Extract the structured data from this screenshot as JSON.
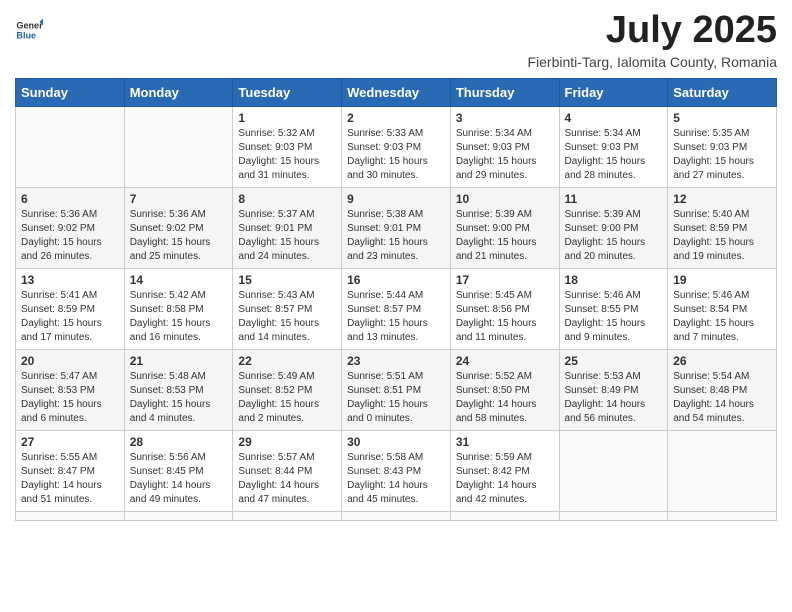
{
  "logo": {
    "text_general": "General",
    "text_blue": "Blue"
  },
  "title": {
    "month": "July 2025",
    "location": "Fierbinti-Targ, Ialomita County, Romania"
  },
  "weekdays": [
    "Sunday",
    "Monday",
    "Tuesday",
    "Wednesday",
    "Thursday",
    "Friday",
    "Saturday"
  ],
  "days": [
    null,
    null,
    {
      "num": "1",
      "sunrise": "5:32 AM",
      "sunset": "9:03 PM",
      "daylight": "15 hours and 31 minutes."
    },
    {
      "num": "2",
      "sunrise": "5:33 AM",
      "sunset": "9:03 PM",
      "daylight": "15 hours and 30 minutes."
    },
    {
      "num": "3",
      "sunrise": "5:34 AM",
      "sunset": "9:03 PM",
      "daylight": "15 hours and 29 minutes."
    },
    {
      "num": "4",
      "sunrise": "5:34 AM",
      "sunset": "9:03 PM",
      "daylight": "15 hours and 28 minutes."
    },
    {
      "num": "5",
      "sunrise": "5:35 AM",
      "sunset": "9:03 PM",
      "daylight": "15 hours and 27 minutes."
    },
    {
      "num": "6",
      "sunrise": "5:36 AM",
      "sunset": "9:02 PM",
      "daylight": "15 hours and 26 minutes."
    },
    {
      "num": "7",
      "sunrise": "5:36 AM",
      "sunset": "9:02 PM",
      "daylight": "15 hours and 25 minutes."
    },
    {
      "num": "8",
      "sunrise": "5:37 AM",
      "sunset": "9:01 PM",
      "daylight": "15 hours and 24 minutes."
    },
    {
      "num": "9",
      "sunrise": "5:38 AM",
      "sunset": "9:01 PM",
      "daylight": "15 hours and 23 minutes."
    },
    {
      "num": "10",
      "sunrise": "5:39 AM",
      "sunset": "9:00 PM",
      "daylight": "15 hours and 21 minutes."
    },
    {
      "num": "11",
      "sunrise": "5:39 AM",
      "sunset": "9:00 PM",
      "daylight": "15 hours and 20 minutes."
    },
    {
      "num": "12",
      "sunrise": "5:40 AM",
      "sunset": "8:59 PM",
      "daylight": "15 hours and 19 minutes."
    },
    {
      "num": "13",
      "sunrise": "5:41 AM",
      "sunset": "8:59 PM",
      "daylight": "15 hours and 17 minutes."
    },
    {
      "num": "14",
      "sunrise": "5:42 AM",
      "sunset": "8:58 PM",
      "daylight": "15 hours and 16 minutes."
    },
    {
      "num": "15",
      "sunrise": "5:43 AM",
      "sunset": "8:57 PM",
      "daylight": "15 hours and 14 minutes."
    },
    {
      "num": "16",
      "sunrise": "5:44 AM",
      "sunset": "8:57 PM",
      "daylight": "15 hours and 13 minutes."
    },
    {
      "num": "17",
      "sunrise": "5:45 AM",
      "sunset": "8:56 PM",
      "daylight": "15 hours and 11 minutes."
    },
    {
      "num": "18",
      "sunrise": "5:46 AM",
      "sunset": "8:55 PM",
      "daylight": "15 hours and 9 minutes."
    },
    {
      "num": "19",
      "sunrise": "5:46 AM",
      "sunset": "8:54 PM",
      "daylight": "15 hours and 7 minutes."
    },
    {
      "num": "20",
      "sunrise": "5:47 AM",
      "sunset": "8:53 PM",
      "daylight": "15 hours and 6 minutes."
    },
    {
      "num": "21",
      "sunrise": "5:48 AM",
      "sunset": "8:53 PM",
      "daylight": "15 hours and 4 minutes."
    },
    {
      "num": "22",
      "sunrise": "5:49 AM",
      "sunset": "8:52 PM",
      "daylight": "15 hours and 2 minutes."
    },
    {
      "num": "23",
      "sunrise": "5:51 AM",
      "sunset": "8:51 PM",
      "daylight": "15 hours and 0 minutes."
    },
    {
      "num": "24",
      "sunrise": "5:52 AM",
      "sunset": "8:50 PM",
      "daylight": "14 hours and 58 minutes."
    },
    {
      "num": "25",
      "sunrise": "5:53 AM",
      "sunset": "8:49 PM",
      "daylight": "14 hours and 56 minutes."
    },
    {
      "num": "26",
      "sunrise": "5:54 AM",
      "sunset": "8:48 PM",
      "daylight": "14 hours and 54 minutes."
    },
    {
      "num": "27",
      "sunrise": "5:55 AM",
      "sunset": "8:47 PM",
      "daylight": "14 hours and 51 minutes."
    },
    {
      "num": "28",
      "sunrise": "5:56 AM",
      "sunset": "8:45 PM",
      "daylight": "14 hours and 49 minutes."
    },
    {
      "num": "29",
      "sunrise": "5:57 AM",
      "sunset": "8:44 PM",
      "daylight": "14 hours and 47 minutes."
    },
    {
      "num": "30",
      "sunrise": "5:58 AM",
      "sunset": "8:43 PM",
      "daylight": "14 hours and 45 minutes."
    },
    {
      "num": "31",
      "sunrise": "5:59 AM",
      "sunset": "8:42 PM",
      "daylight": "14 hours and 42 minutes."
    },
    null,
    null,
    null,
    null,
    null,
    null
  ]
}
